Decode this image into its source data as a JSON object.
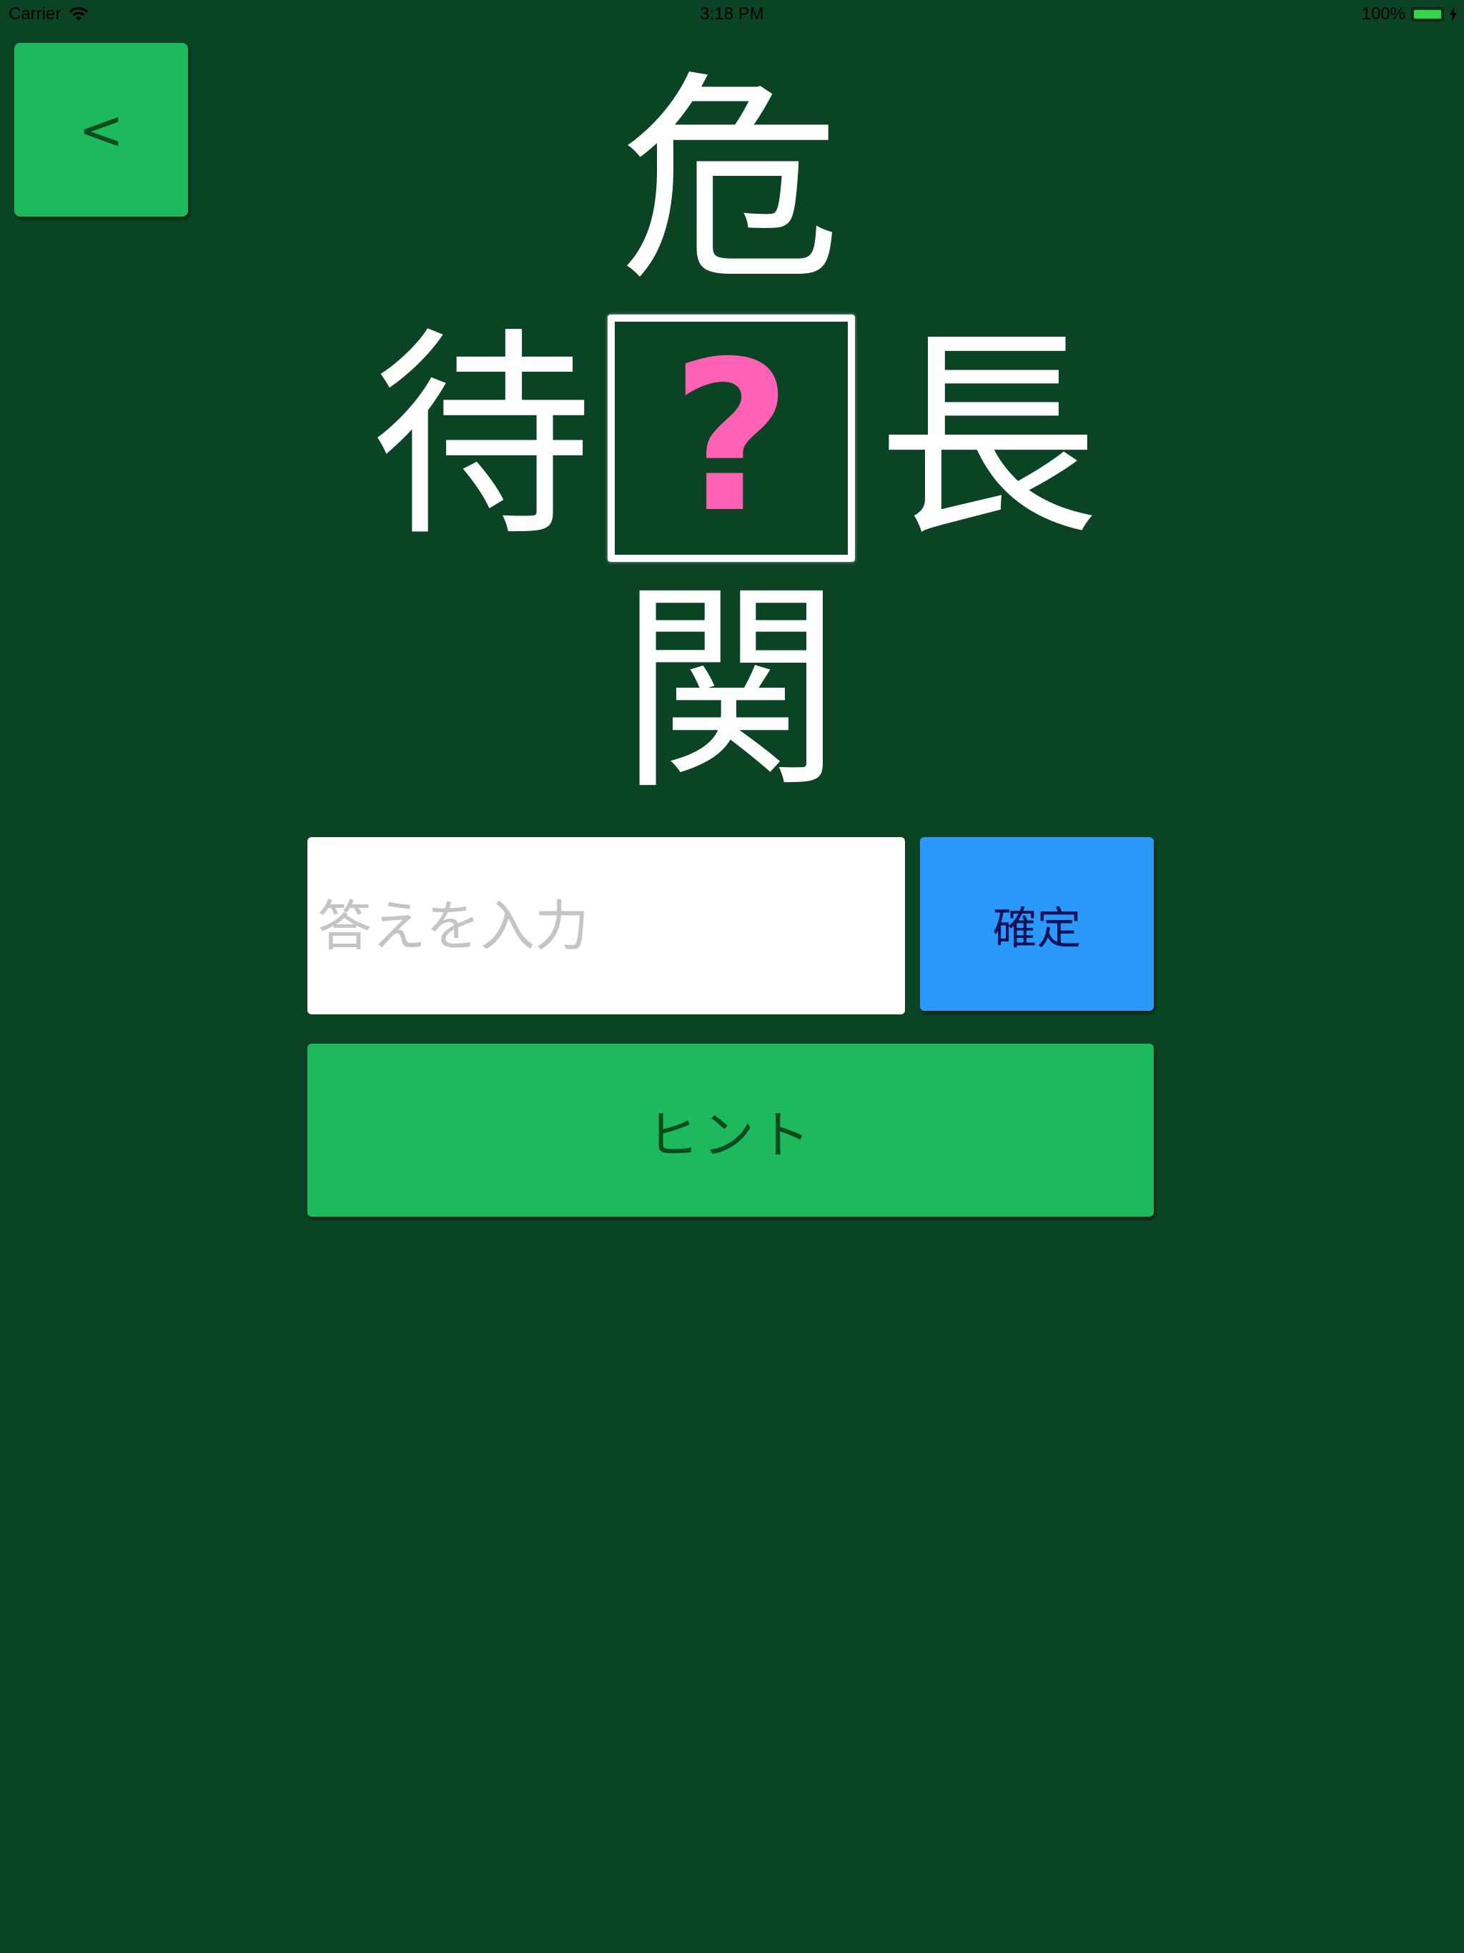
{
  "status_bar": {
    "carrier": "Carrier",
    "time": "3:18 PM",
    "battery_percent": "100%",
    "battery_level": 1.0,
    "icons": [
      "wifi-icon",
      "battery-icon",
      "charging-bolt-icon"
    ]
  },
  "navigation": {
    "back_label": "<"
  },
  "puzzle": {
    "top": "危",
    "left": "待",
    "right": "長",
    "bottom": "関",
    "unknown": "?"
  },
  "answer": {
    "placeholder": "答えを入力",
    "value": "",
    "confirm_label": "確定"
  },
  "hint": {
    "label": "ヒント"
  },
  "colors": {
    "background": "#0b4424",
    "button_green": "#1db95c",
    "button_blue": "#2b99fc",
    "question_pink": "#ff61b5",
    "kanji_white": "#ffffff"
  }
}
